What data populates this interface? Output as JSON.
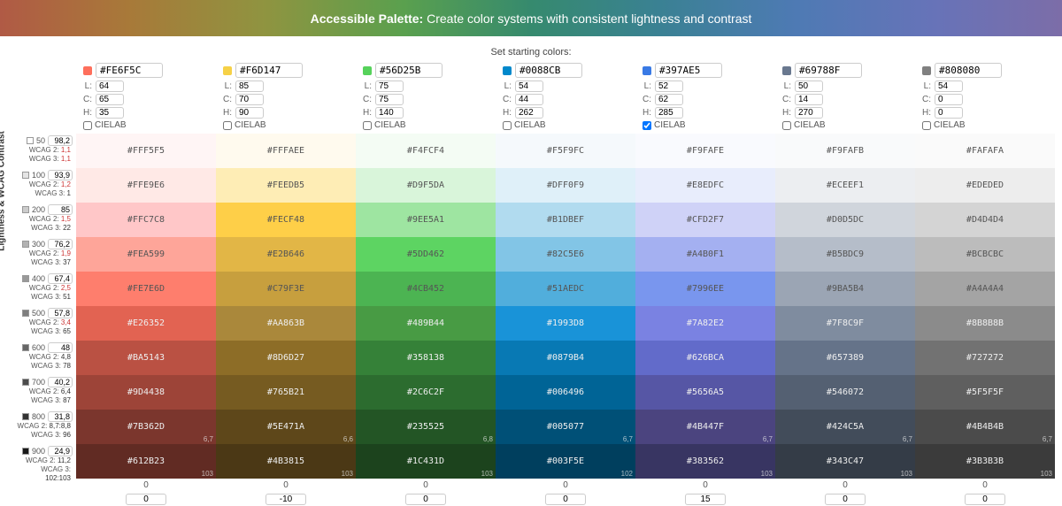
{
  "header": {
    "bold": "Accessible Palette:",
    "rest": " Create color systems with consistent lightness and contrast"
  },
  "subtitle": "Set starting colors:",
  "sidebar_label": "Lightness & WCAG Contrast",
  "cielab_label": "CIELAB",
  "columns": [
    {
      "hex": "#FE6F5C",
      "L": "64",
      "C": "65",
      "H": "35"
    },
    {
      "hex": "#F6D147",
      "L": "85",
      "C": "70",
      "H": "90"
    },
    {
      "hex": "#56D25B",
      "L": "75",
      "C": "75",
      "H": "140"
    },
    {
      "hex": "#0088CB",
      "L": "54",
      "C": "44",
      "H": "262"
    },
    {
      "hex": "#397AE5",
      "L": "52",
      "C": "62",
      "H": "285",
      "checked": true
    },
    {
      "hex": "#69788F",
      "L": "50",
      "C": "14",
      "H": "270"
    },
    {
      "hex": "#808080",
      "L": "54",
      "C": "0",
      "H": "0"
    }
  ],
  "rows": [
    {
      "shade": "50",
      "L": "98,2",
      "w2": "1,1",
      "w3": "1,1",
      "w2fail": true,
      "w3fail": true
    },
    {
      "shade": "100",
      "L": "93,9",
      "w2": "1,2",
      "w3": "1",
      "w2fail": true,
      "w3fail": false
    },
    {
      "shade": "200",
      "L": "85",
      "w2": "1,5",
      "w3": "22",
      "w2fail": true,
      "w3fail": false
    },
    {
      "shade": "300",
      "L": "76,2",
      "w2": "1,9",
      "w3": "37",
      "w2fail": true,
      "w3fail": false
    },
    {
      "shade": "400",
      "L": "67,4",
      "w2": "2,5",
      "w3": "51",
      "w2fail": true,
      "w3fail": false
    },
    {
      "shade": "500",
      "L": "57,8",
      "w2": "3,4",
      "w3": "65",
      "w2fail": true,
      "w3fail": false
    },
    {
      "shade": "600",
      "L": "48",
      "w2": "4,8",
      "w3": "78"
    },
    {
      "shade": "700",
      "L": "40,2",
      "w2": "6,4",
      "w3": "87"
    },
    {
      "shade": "800",
      "L": "31,8",
      "w2": "8,7:8,8",
      "w3": "96"
    },
    {
      "shade": "900",
      "L": "24,9",
      "w2": "11,2",
      "w3": "102:103"
    }
  ],
  "cells": [
    [
      {
        "h": "#FFF5F5",
        "c": "#FFF5F5",
        "t": "#555"
      },
      {
        "h": "#FFFAEE",
        "c": "#FFFAEE",
        "t": "#555"
      },
      {
        "h": "#F4FCF4",
        "c": "#F4FCF4",
        "t": "#555"
      },
      {
        "h": "#F5F9FC",
        "c": "#F5F9FC",
        "t": "#555"
      },
      {
        "h": "#F9FAFE",
        "c": "#F9FAFE",
        "t": "#555"
      },
      {
        "h": "#F9FAFB",
        "c": "#F9FAFB",
        "t": "#555"
      },
      {
        "h": "#FAFAFA",
        "c": "#FAFAFA",
        "t": "#555"
      }
    ],
    [
      {
        "h": "#FFE9E6",
        "c": "#FFE9E6",
        "t": "#555"
      },
      {
        "h": "#FEEDB5",
        "c": "#FEEDB5",
        "t": "#555"
      },
      {
        "h": "#D9F5DA",
        "c": "#D9F5DA",
        "t": "#555"
      },
      {
        "h": "#DFF0F9",
        "c": "#DFF0F9",
        "t": "#555"
      },
      {
        "h": "#E8EDFC",
        "c": "#E8EDFC",
        "t": "#555"
      },
      {
        "h": "#ECEEF1",
        "c": "#ECEEF1",
        "t": "#555"
      },
      {
        "h": "#EDEDED",
        "c": "#EDEDED",
        "t": "#555"
      }
    ],
    [
      {
        "h": "#FFC7C8",
        "c": "#FFC7C8",
        "t": "#555"
      },
      {
        "h": "#FECF48",
        "c": "#FECF48",
        "t": "#555"
      },
      {
        "h": "#9EE5A1",
        "c": "#9EE5A1",
        "t": "#555"
      },
      {
        "h": "#B1DBEF",
        "c": "#B1DBEF",
        "t": "#555"
      },
      {
        "h": "#CFD2F7",
        "c": "#CFD2F7",
        "t": "#555"
      },
      {
        "h": "#D0D5DC",
        "c": "#D0D5DC",
        "t": "#555"
      },
      {
        "h": "#D4D4D4",
        "c": "#D4D4D4",
        "t": "#555"
      }
    ],
    [
      {
        "h": "#FEA599",
        "c": "#FEA599",
        "t": "#555"
      },
      {
        "h": "#E2B646",
        "c": "#E2B646",
        "t": "#555"
      },
      {
        "h": "#5DD462",
        "c": "#5DD462",
        "t": "#555"
      },
      {
        "h": "#82C5E6",
        "c": "#82C5E6",
        "t": "#555"
      },
      {
        "h": "#A4B0F1",
        "c": "#A4B0F1",
        "t": "#555"
      },
      {
        "h": "#B5BDC9",
        "c": "#B5BDC9",
        "t": "#555"
      },
      {
        "h": "#BCBCBC",
        "c": "#BCBCBC",
        "t": "#555"
      }
    ],
    [
      {
        "h": "#FE7E6D",
        "c": "#FE7E6D",
        "t": "#555"
      },
      {
        "h": "#C79F3E",
        "c": "#C79F3E",
        "t": "#555"
      },
      {
        "h": "#4CB452",
        "c": "#4CB452",
        "t": "#555"
      },
      {
        "h": "#51AEDC",
        "c": "#51AEDC",
        "t": "#555"
      },
      {
        "h": "#7996EE",
        "c": "#7996EE",
        "t": "#555"
      },
      {
        "h": "#9BA5B4",
        "c": "#9BA5B4",
        "t": "#555"
      },
      {
        "h": "#A4A4A4",
        "c": "#A4A4A4",
        "t": "#555"
      }
    ],
    [
      {
        "h": "#E26352",
        "c": "#E26352",
        "t": "#eee"
      },
      {
        "h": "#AA863B",
        "c": "#AA883B",
        "t": "#eee"
      },
      {
        "h": "#489B44",
        "c": "#489B44",
        "t": "#eee"
      },
      {
        "h": "#1993D8",
        "c": "#1993D8",
        "t": "#eee"
      },
      {
        "h": "#7A82E2",
        "c": "#7A82E2",
        "t": "#eee"
      },
      {
        "h": "#7F8C9F",
        "c": "#7F8C9F",
        "t": "#eee"
      },
      {
        "h": "#8B8B8B",
        "c": "#8B8B8B",
        "t": "#eee"
      }
    ],
    [
      {
        "h": "#BA5143",
        "c": "#BA5143",
        "t": "#eee"
      },
      {
        "h": "#8D6D27",
        "c": "#8D6D27",
        "t": "#eee"
      },
      {
        "h": "#358138",
        "c": "#358138",
        "t": "#eee"
      },
      {
        "h": "#0879B4",
        "c": "#0879B4",
        "t": "#eee"
      },
      {
        "h": "#626BCA",
        "c": "#626BCA",
        "t": "#eee"
      },
      {
        "h": "#657389",
        "c": "#657389",
        "t": "#eee"
      },
      {
        "h": "#727272",
        "c": "#727272",
        "t": "#eee"
      }
    ],
    [
      {
        "h": "#9D4438",
        "c": "#9D4438",
        "t": "#eee"
      },
      {
        "h": "#765B21",
        "c": "#765B21",
        "t": "#eee"
      },
      {
        "h": "#2C6C2F",
        "c": "#2C6C2F",
        "t": "#eee"
      },
      {
        "h": "#006496",
        "c": "#006496",
        "t": "#eee"
      },
      {
        "h": "#5656A5",
        "c": "#5656A5",
        "t": "#eee"
      },
      {
        "h": "#546072",
        "c": "#546072",
        "t": "#eee"
      },
      {
        "h": "#5F5F5F",
        "c": "#5F5F5F",
        "t": "#eee"
      }
    ],
    [
      {
        "h": "#7B362D",
        "c": "#7B362D",
        "t": "#eee",
        "cr": "6,7"
      },
      {
        "h": "#5E471A",
        "c": "#5E471A",
        "t": "#eee",
        "cr": "6,6"
      },
      {
        "h": "#235525",
        "c": "#235525",
        "t": "#eee",
        "cr": "6,8"
      },
      {
        "h": "#005077",
        "c": "#005077",
        "t": "#eee",
        "cr": "6,7"
      },
      {
        "h": "#4B447F",
        "c": "#4B447F",
        "t": "#eee",
        "cr": "6,7"
      },
      {
        "h": "#424C5A",
        "c": "#424C5A",
        "t": "#eee",
        "cr": "6,7"
      },
      {
        "h": "#4B4B4B",
        "c": "#4B4B4B",
        "t": "#eee",
        "cr": "6,7"
      }
    ],
    [
      {
        "h": "#612B23",
        "c": "#612B23",
        "t": "#eee",
        "cr": "103"
      },
      {
        "h": "#4B3815",
        "c": "#4B3815",
        "t": "#eee",
        "cr": "103"
      },
      {
        "h": "#1C431D",
        "c": "#1C431D",
        "t": "#eee",
        "cr": "103"
      },
      {
        "h": "#003F5E",
        "c": "#003F5E",
        "t": "#eee",
        "cr": "102"
      },
      {
        "h": "#383562",
        "c": "#383562",
        "t": "#eee",
        "cr": "103"
      },
      {
        "h": "#343C47",
        "c": "#343C47",
        "t": "#eee",
        "cr": "103"
      },
      {
        "h": "#3B3B3B",
        "c": "#3B3B3B",
        "t": "#eee",
        "cr": "103"
      }
    ]
  ],
  "footer_disp": [
    "0",
    "0",
    "0",
    "0",
    "0",
    "0",
    "0"
  ],
  "footer_in": [
    "0",
    "-10",
    "0",
    "0",
    "15",
    "0",
    "0"
  ]
}
